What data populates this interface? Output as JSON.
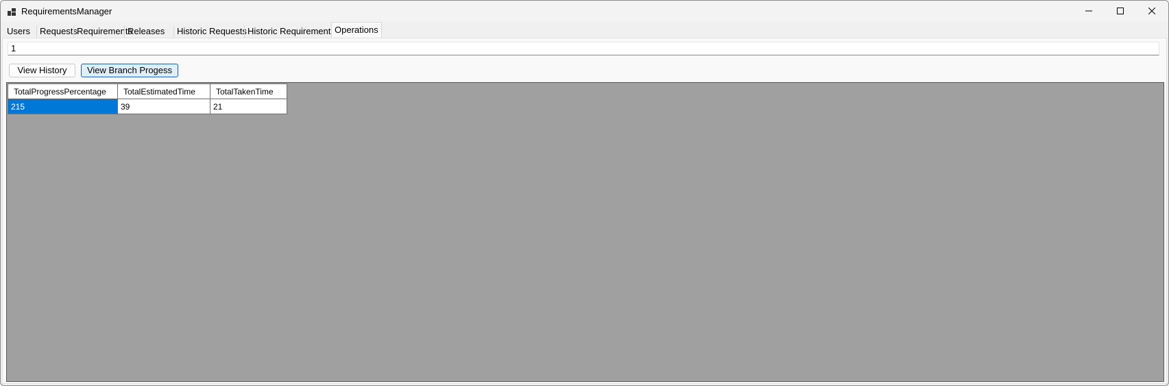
{
  "window": {
    "title": "RequirementsManager"
  },
  "tabs": [
    {
      "label": "Users"
    },
    {
      "label": "Requests"
    },
    {
      "label": "Requirements"
    },
    {
      "label": "Releases"
    },
    {
      "label": "Historic Requests"
    },
    {
      "label": "Historic Requirements"
    },
    {
      "label": "Operations",
      "active": true
    }
  ],
  "operations": {
    "search_value": "1",
    "view_history_label": "View History",
    "view_branch_label": "View Branch Progess"
  },
  "grid": {
    "columns": [
      "TotalProgressPercentage",
      "TotalEstimatedTime",
      "TotalTakenTime"
    ],
    "rows": [
      [
        "215",
        "39",
        "21"
      ]
    ]
  },
  "colors": {
    "selection": "#0078d7",
    "grid_background": "#a0a0a0",
    "primary_button_border": "#0067c0"
  },
  "icons": {
    "app": "app-icon",
    "minimize": "minimize-icon",
    "maximize": "maximize-icon",
    "close": "close-icon"
  }
}
